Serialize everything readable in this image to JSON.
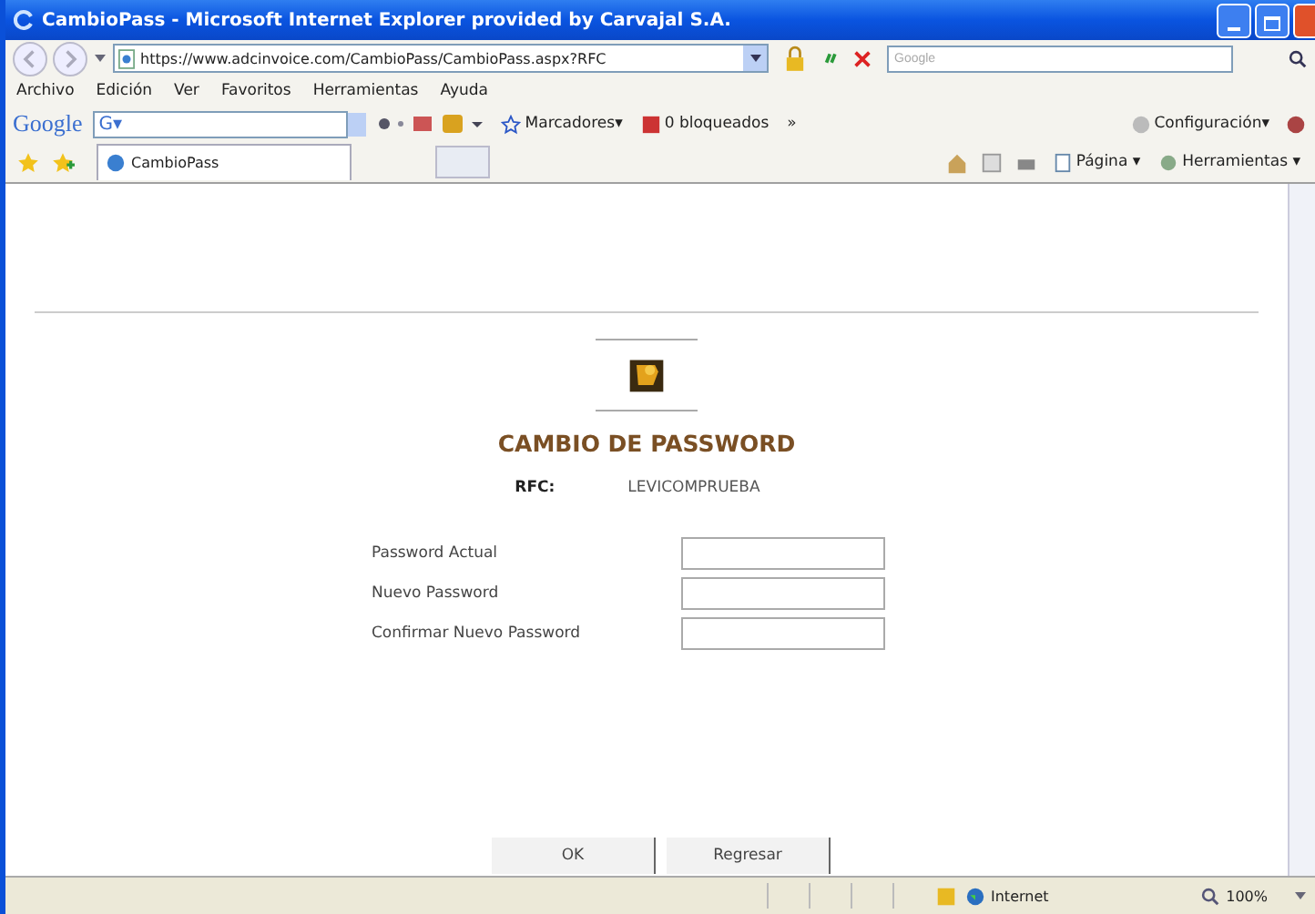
{
  "window": {
    "title": "CambioPass - Microsoft Internet Explorer provided by Carvajal S.A."
  },
  "address_bar": {
    "url": "https://www.adcinvoice.com/CambioPass/CambioPass.aspx?RFC",
    "search_placeholder": "Google"
  },
  "menu": [
    "Archivo",
    "Edición",
    "Ver",
    "Favoritos",
    "Herramientas",
    "Ayuda"
  ],
  "google_toolbar": {
    "logo": "Google",
    "field": "G▾",
    "bookmarks": "Marcadores▾",
    "blocked": "0 bloqueados",
    "more": "»",
    "settings": "Configuración▾"
  },
  "tabs": [
    {
      "label": "CambioPass",
      "selected": true
    }
  ],
  "command_bar": {
    "page": "Página ▾",
    "tools": "Herramientas ▾"
  },
  "page": {
    "heading": "CAMBIO DE PASSWORD",
    "rfc_label": "RFC:",
    "rfc_value": "LEVICOMPRUEBA",
    "fields": [
      {
        "label": "Password Actual"
      },
      {
        "label": "Nuevo Password"
      },
      {
        "label": "Confirmar Nuevo Password"
      }
    ],
    "buttons": [
      "OK",
      "Regresar"
    ]
  },
  "status_bar": {
    "zone": "Internet",
    "zoom": "100%"
  }
}
